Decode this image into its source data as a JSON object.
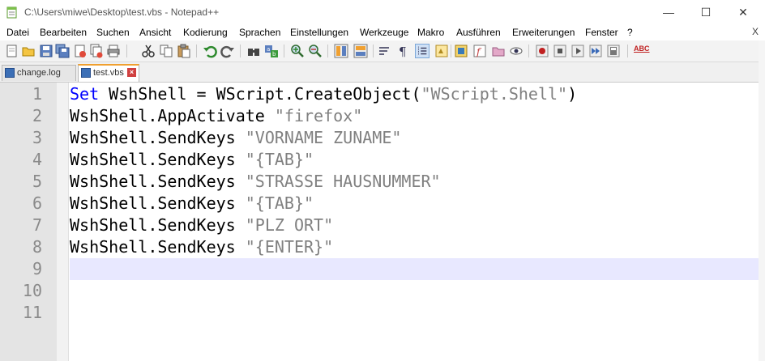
{
  "window": {
    "title": "C:\\Users\\miwe\\Desktop\\test.vbs - Notepad++",
    "minimize": "—",
    "maximize": "☐",
    "close": "✕"
  },
  "menu": {
    "items": [
      "Datei",
      "Bearbeiten",
      "Suchen",
      "Ansicht",
      "Kodierung",
      "Sprachen",
      "Einstellungen",
      "Werkzeuge",
      "Makro",
      "Ausführen",
      "Erweiterungen",
      "Fenster",
      "?"
    ],
    "close": "X"
  },
  "toolbar": {
    "icons": [
      "new-file-icon",
      "open-file-icon",
      "save-icon",
      "save-all-icon",
      "close-file-icon",
      "close-all-icon",
      "print-icon",
      "cut-icon",
      "copy-icon",
      "paste-icon",
      "undo-icon",
      "redo-icon",
      "find-icon",
      "replace-icon",
      "zoom-in-icon",
      "zoom-out-icon",
      "sync-v-icon",
      "sync-h-icon",
      "word-wrap-icon",
      "show-all-chars-icon",
      "indent-guide-icon",
      "udl-icon",
      "doc-map-icon",
      "function-list-icon",
      "folder-workspace-icon",
      "monitor-icon",
      "record-macro-icon",
      "stop-macro-icon",
      "play-macro-icon",
      "run-macro-multiple-icon",
      "save-macro-icon",
      "spellcheck-icon"
    ],
    "spellcheck_label": "ABC"
  },
  "tabs": [
    {
      "label": "change.log",
      "active": false
    },
    {
      "label": "test.vbs",
      "active": true
    }
  ],
  "editor": {
    "current_line": 9,
    "lines": [
      {
        "num": "1",
        "tokens": [
          {
            "t": "Set",
            "c": "kw"
          },
          {
            "t": " WshShell = WScript.CreateObject(",
            "c": ""
          },
          {
            "t": "\"WScript.Shell\"",
            "c": "str"
          },
          {
            "t": ")",
            "c": ""
          }
        ]
      },
      {
        "num": "2",
        "tokens": [
          {
            "t": "WshShell.AppActivate ",
            "c": ""
          },
          {
            "t": "\"firefox\"",
            "c": "str"
          }
        ]
      },
      {
        "num": "3",
        "tokens": [
          {
            "t": "WshShell.SendKeys ",
            "c": ""
          },
          {
            "t": "\"VORNAME ZUNAME\"",
            "c": "str"
          }
        ]
      },
      {
        "num": "4",
        "tokens": [
          {
            "t": "WshShell.SendKeys ",
            "c": ""
          },
          {
            "t": "\"{TAB}\"",
            "c": "str"
          }
        ]
      },
      {
        "num": "5",
        "tokens": [
          {
            "t": "WshShell.SendKeys ",
            "c": ""
          },
          {
            "t": "\"STRASSE HAUSNUMMER\"",
            "c": "str"
          }
        ]
      },
      {
        "num": "6",
        "tokens": [
          {
            "t": "WshShell.SendKeys ",
            "c": ""
          },
          {
            "t": "\"{TAB}\"",
            "c": "str"
          }
        ]
      },
      {
        "num": "7",
        "tokens": [
          {
            "t": "WshShell.SendKeys ",
            "c": ""
          },
          {
            "t": "\"PLZ ORT\"",
            "c": "str"
          }
        ]
      },
      {
        "num": "8",
        "tokens": [
          {
            "t": "WshShell.SendKeys ",
            "c": ""
          },
          {
            "t": "\"{ENTER}\"",
            "c": "str"
          }
        ]
      },
      {
        "num": "9",
        "tokens": []
      },
      {
        "num": "10",
        "tokens": []
      },
      {
        "num": "11",
        "tokens": []
      }
    ]
  },
  "colors": {
    "keyword": "#0000ff",
    "string": "#808080",
    "current_line_bg": "#e8e8ff",
    "gutter_bg": "#e4e4e4",
    "active_tab_accent": "#f0a030"
  }
}
